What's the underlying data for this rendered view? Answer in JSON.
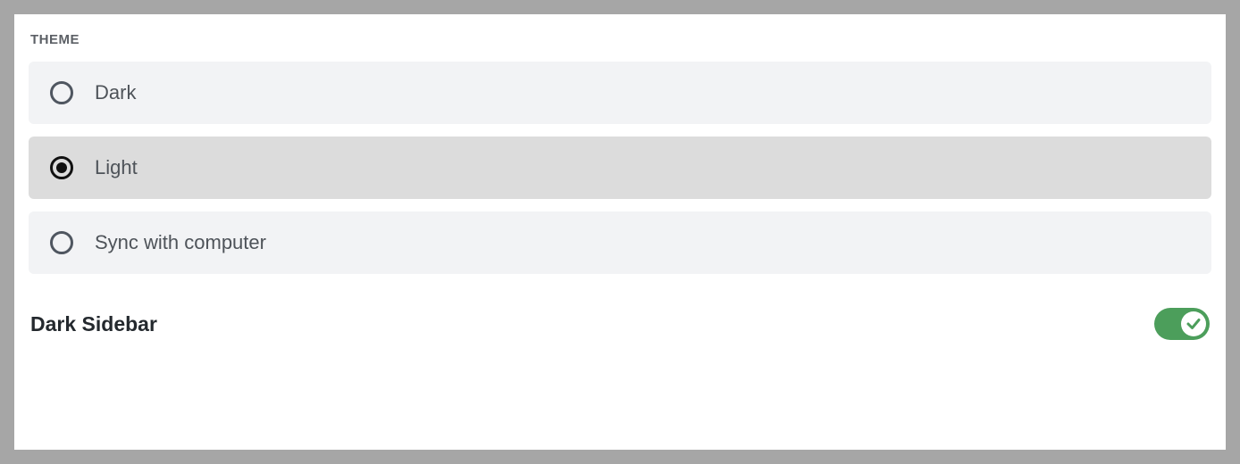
{
  "section": {
    "header": "THEME"
  },
  "theme_options": [
    {
      "id": "dark",
      "label": "Dark",
      "selected": false
    },
    {
      "id": "light",
      "label": "Light",
      "selected": true
    },
    {
      "id": "sync",
      "label": "Sync with computer",
      "selected": false
    }
  ],
  "dark_sidebar": {
    "label": "Dark Sidebar",
    "enabled": true
  },
  "colors": {
    "toggle_on": "#4c9e5b",
    "option_bg": "#f2f3f5",
    "option_selected_bg": "#dcdcdc"
  }
}
